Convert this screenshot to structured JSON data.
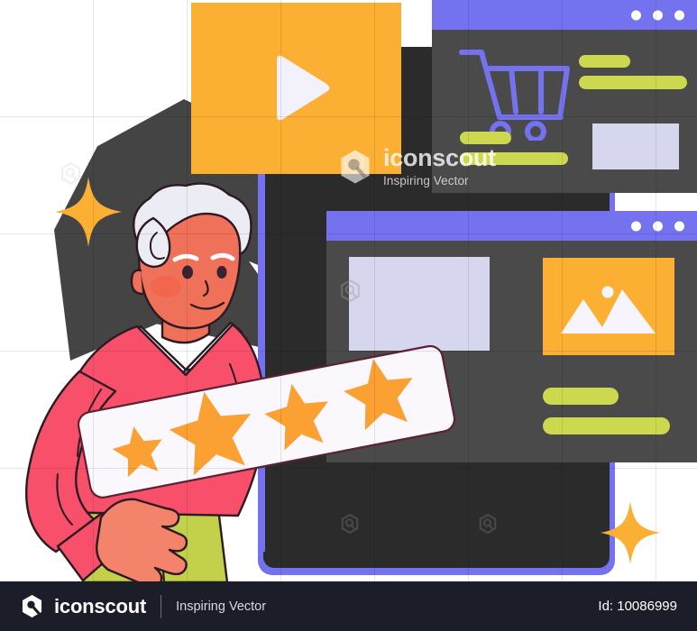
{
  "illustration": {
    "title": "Man holding customer star rating card with e-commerce website windows",
    "alt": "Customer review illustration"
  },
  "watermark": {
    "brand": "iconscout",
    "tagline": "Inspiring Vector",
    "logo_icon": "iconscout-hexagon-magnifier-icon"
  },
  "footer": {
    "brand": "iconscout",
    "tagline": "Inspiring Vector",
    "id_label": "Id: 10086999",
    "logo_icon": "iconscout-hexagon-magnifier-icon"
  },
  "video_card": {
    "name": "video-preview-card",
    "icon": "play-icon",
    "fill": "#fbb034",
    "icon_fill": "#f3f1fb"
  },
  "window_cart": {
    "name": "shopping-window",
    "titlebar_color": "#7472ee",
    "body_color": "#4a4a4a",
    "dots": [
      "dot-1",
      "dot-2",
      "dot-3"
    ],
    "cart_icon": "shopping-cart-icon",
    "cart_color": "#7472ee",
    "bars": [
      {
        "name": "text-bar-short-1",
        "color": "#ccd94f"
      },
      {
        "name": "text-bar-long-1",
        "color": "#ccd94f"
      },
      {
        "name": "text-bar-short-2",
        "color": "#ccd94f"
      },
      {
        "name": "text-bar-long-2",
        "color": "#ccd94f"
      }
    ],
    "placeholder": {
      "name": "image-placeholder",
      "color": "#d7d6ef"
    }
  },
  "window_media": {
    "name": "media-window",
    "titlebar_color": "#7472ee",
    "body_color": "#4a4a4a",
    "dots": [
      "dot-1",
      "dot-2",
      "dot-3"
    ],
    "placeholder": {
      "name": "content-placeholder",
      "color": "#d7d6ef"
    },
    "image_card": {
      "name": "image-thumbnail-card",
      "fill": "#fbb034",
      "icon": "mountain-photo-icon",
      "icon_fill": "#f6f4fc"
    },
    "bars": [
      {
        "name": "text-bar-short",
        "color": "#ccd94f"
      },
      {
        "name": "text-bar-long",
        "color": "#ccd94f"
      }
    ]
  },
  "device": {
    "name": "dark-device-panel",
    "fill": "#2b2b2b",
    "border": "#7472ee"
  },
  "review_card": {
    "name": "star-rating-card",
    "background": "#faf8fd",
    "star_color": "#fba032",
    "rating": 4,
    "max_rating": 5,
    "stars": [
      "star-1",
      "star-2",
      "star-3",
      "star-4"
    ]
  },
  "character": {
    "name": "elderly-man-character",
    "hair_color": "#ececf4",
    "skin_color": "#f4836c",
    "sweater_color": "#f8506a",
    "tie_color": "#7472ee",
    "shirt_color": "#ffffff",
    "pants_color": "#c2d04b"
  },
  "sparkles": [
    {
      "name": "sparkle-left",
      "color": "#fbb034"
    },
    {
      "name": "sparkle-bottom-right",
      "color": "#fbb034"
    }
  ],
  "background": {
    "name": "grid-background",
    "grid_color": "rgba(0,0,0,0.10)",
    "page_color": "#ffffff",
    "accent_shape": {
      "name": "dark-star-shape",
      "color": "#444444"
    }
  }
}
